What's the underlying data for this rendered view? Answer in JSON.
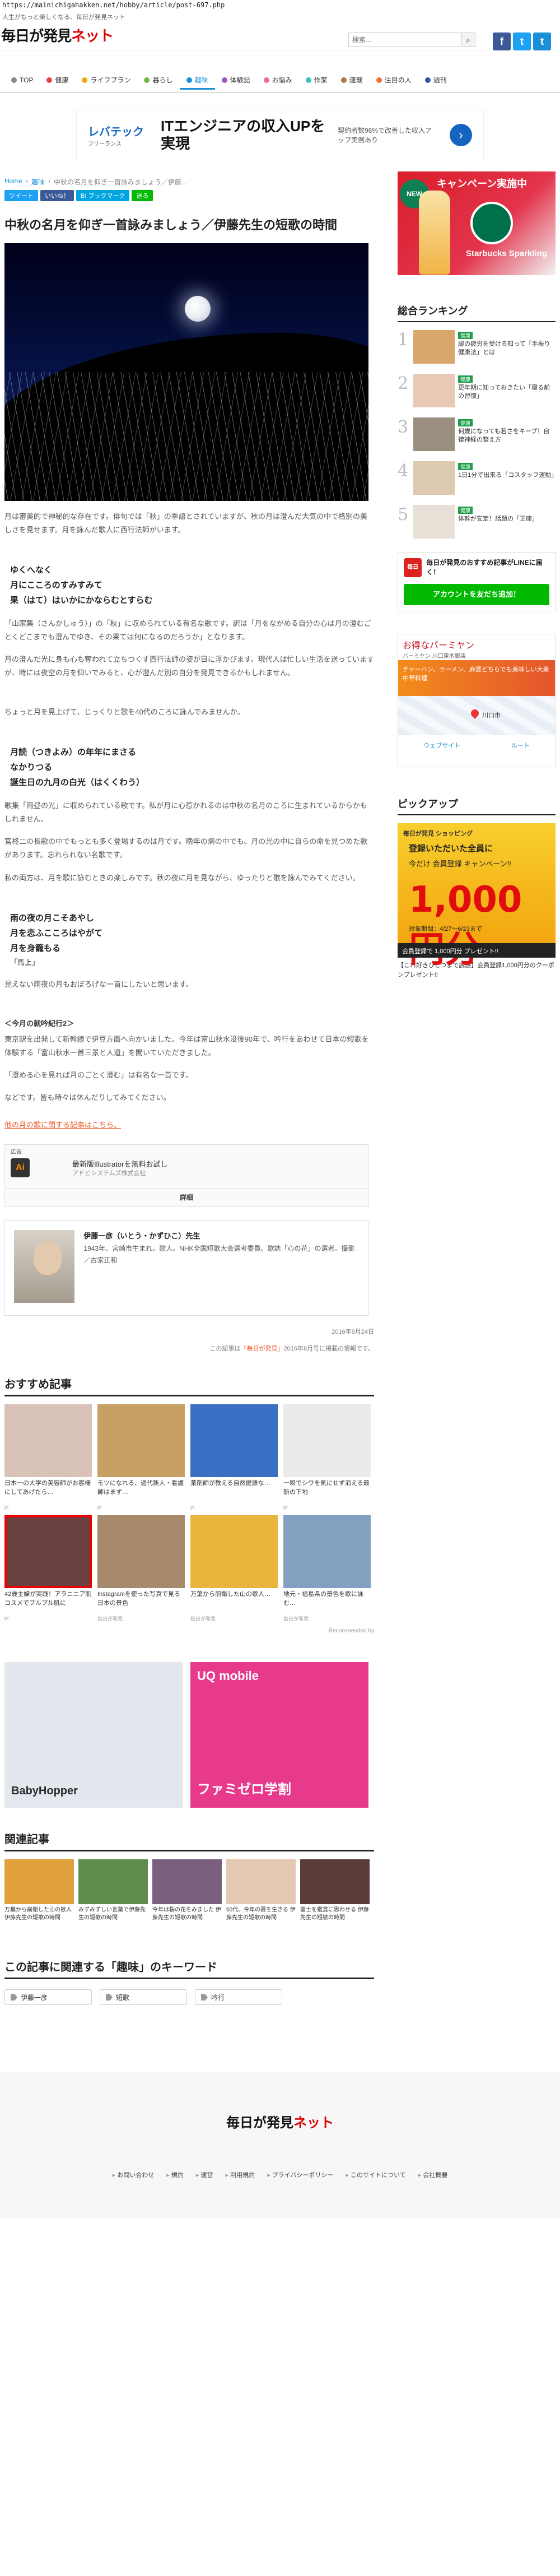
{
  "url": "https://mainichigahakken.net/hobby/article/post-697.php",
  "header": {
    "tagline": "人生がもっと楽しくなる、毎日が発見ネット",
    "logo_main": "毎日が発見",
    "logo_accent": "ネット",
    "search_placeholder": "検索...",
    "social": [
      "f",
      "t",
      "t"
    ]
  },
  "nav": [
    {
      "label": "TOP",
      "color": "#888888"
    },
    {
      "label": "健康",
      "color": "#e8423a"
    },
    {
      "label": "ライフプラン",
      "color": "#f0a81b"
    },
    {
      "label": "暮らし",
      "color": "#6bb93f"
    },
    {
      "label": "趣味",
      "color": "#1b8fd6",
      "active": true
    },
    {
      "label": "体験記",
      "color": "#9b57c2"
    },
    {
      "label": "お悩み",
      "color": "#ec6d9e"
    },
    {
      "label": "作家",
      "color": "#3ec0c5"
    },
    {
      "label": "連載",
      "color": "#b0763f"
    },
    {
      "label": "注目の人",
      "color": "#f56b3c"
    },
    {
      "label": "週刊",
      "color": "#2c57a5"
    }
  ],
  "banner": {
    "brand": "レバテック",
    "brand_sub": "フリーランス",
    "headline": "ITエンジニアの収入UPを実現",
    "sub": "契約者数96%で改善した収入アップ実例あり"
  },
  "breadcrumb": [
    "Home",
    "趣味",
    "中秋の名月を仰ぎ一首詠みましょう／伊藤..."
  ],
  "share": [
    {
      "label": "ツイート",
      "color": "#1da1f2"
    },
    {
      "label": "いいね！",
      "color": "#3b5998"
    },
    {
      "label": "B! ブックマーク",
      "color": "#00a4de"
    },
    {
      "label": "送る",
      "color": "#00b900"
    }
  ],
  "article": {
    "title": "中秋の名月を仰ぎ一首詠みましょう／伊藤先生の短歌の時間",
    "p1": "月は審美的で神秘的な存在です。俳句では「秋」の季語とされていますが、秋の月は澄んだ大気の中で格別の美しさを見せます。月を詠んだ歌人に西行法師がいます。",
    "poem1": [
      "ゆくへなく",
      "月にこころのすみすみて",
      "果（はて）はいかにかならむとすらむ"
    ],
    "p2": "「山家集（さんかしゅう）」の「秋」に収められている有名な歌です。訳は「月をながめる自分の心は月の澄むごとくどこまでも澄んでゆき、その果ては何になるのだろうか」となります。",
    "p3": "月の澄んだ光に身も心も奪われて立ちつくす西行法師の姿が目に浮かびます。現代人は忙しい生活を送っていますが、時には夜空の月を仰いでみると、心が澄んだ別の自分を発見できるかもしれません。",
    "p4": "ちょっと月を見上げて、じっくりと歌を40代のころに詠んでみませんか。",
    "poem2": [
      "月読（つきよみ）の年年にまさる",
      "なかりつる",
      "誕生日の九月の白光（はくくわう）"
    ],
    "p5": "歌集「雨昼の光」に収められている歌です。私が月に心惹かれるのは中秋の名月のころに生まれているからかもしれません。",
    "p6": "宮柊二の長歌の中でもっとも多く登場するのは月です。晩年の病の中でも、月の光の中に自らの命を見つめた歌があります。忘れられない名歌です。",
    "p7": "私の両方は、月を歌に詠むときの楽しみです。秋の夜に月を見ながら、ゆったりと歌を詠んでみてください。",
    "poem3": [
      "雨の夜の月こそあやし",
      "月を恋ふこころはやがて",
      "月を身籠もる"
    ],
    "poem3_note": "「馬上」",
    "p8": "見えない雨夜の月もおぼろげな一首にしたいと思います。",
    "event_title": "＜今月の就吟紀行2＞",
    "p9": "東京駅を出発して新幹線で伊豆方面へ向かいました。今年は富山秋水没後90年で、吟行をあわせて日本の短歌を体験する「富山秋水一首三景と人道」を開いていただきました。",
    "p10": "「澄める心を見れば月のごとく澄む」は有名な一首です。",
    "p11": "などです。皆も時々は休んだりしてみてください。",
    "link": "他の月の歌に関する記事はこちら。",
    "ad": {
      "tag": "広告",
      "title": "最新版Illustratorを無料お試し",
      "sub": "アドビシステムズ株式会社",
      "open": "詳細"
    },
    "author_name": "伊藤一彦（いとう・かずひこ）先生",
    "author_bio": "1943年、宮崎市生まれ。歌人。NHK全国短歌大会選考委員。歌誌「心の花」の選者。撮影／古家正和",
    "pubdate": "2016年8月24日",
    "credit_prefix": "この記事は",
    "credit_link": "『毎日が発見』",
    "credit_suffix": "2016年8月号に掲載の情報です。"
  },
  "recommended": {
    "title": "おすすめ記事",
    "items": [
      {
        "cap": "日本一の大学の美容師がお客様にしてあげたら…",
        "src": "pr",
        "color": "#d9c3b8"
      },
      {
        "cap": "モツになれる、週代新人・看護師はまず…",
        "src": "pr",
        "color": "#c9a064"
      },
      {
        "cap": "薬剤師が教える自然健康な…",
        "src": "pr",
        "color": "#3b6fc4"
      },
      {
        "cap": "一瞬でシワを気にせず消える最新の下地",
        "src": "pr",
        "color": "#ebebeb"
      },
      {
        "cap": "42歳主婦が実践！アラニニア肌コスメでプルプル肌に",
        "src": "pr",
        "color": "#6a4040",
        "highlight": true
      },
      {
        "cap": "Instagramを使った写真で見る日本の景色",
        "src": "毎日が発見",
        "color": "#a78a6c"
      },
      {
        "cap": "万葉から前衛した山の歌人…",
        "src": "毎日が発見",
        "color": "#e8b63c"
      },
      {
        "cap": "地元・福島県の景色を歌に詠む…",
        "src": "毎日が発見",
        "color": "#83a0c0"
      }
    ],
    "footer": "Recommended by"
  },
  "ads": [
    {
      "label": "BabyHopper",
      "color": "#e3e7ee"
    },
    {
      "label": "UQ mobile",
      "sub": "ファミゼロ学割",
      "color": "#e73a8d"
    }
  ],
  "related": {
    "title": "関連記事",
    "items": [
      {
        "cap": "万葉から前衛した山の歌人 伊藤先生の短歌の時間",
        "color": "#e0a03c"
      },
      {
        "cap": "みずみずしい言葉で伊藤先生の短歌の時間",
        "color": "#5f8b4c"
      },
      {
        "cap": "今年は桜の花をみました 伊藤先生の短歌の時間",
        "color": "#7a5f7f"
      },
      {
        "cap": "50代、今年の夏を生きる 伊藤先生の短歌の時間",
        "color": "#e4c9b2"
      },
      {
        "cap": "富士を鑑賞に思わせる 伊藤先生の短歌の時間",
        "color": "#5a3c3a"
      }
    ]
  },
  "keywords": {
    "title": "この記事に関連する「趣味」のキーワード",
    "items": [
      "伊藤一彦",
      "短歌",
      "吟行"
    ]
  },
  "footer": {
    "logo_main": "毎日が発見",
    "logo_accent": "ネット",
    "links": [
      "お問い合わせ",
      "規約",
      "運営",
      "利用規約",
      "プライバシーポリシー",
      "このサイトについて",
      "会社概要"
    ]
  },
  "sidebar": {
    "ad_new": "NEW",
    "ad_campaign": "キャンペーン実施中",
    "ad_brand": "Starbucks Sparkling",
    "ranking_title": "総合ランキング",
    "ranking": [
      {
        "num": "1",
        "tag": "健康",
        "text": "脚の疲労を受ける知って「手振り健康法」とは",
        "color": "#d9a66b"
      },
      {
        "num": "2",
        "tag": "健康",
        "text": "更年期に知っておきたい「寝る前の習慣」",
        "color": "#eac8b6"
      },
      {
        "num": "3",
        "tag": "健康",
        "text": "何歳になっても若さをキープ！自律神経の整え方",
        "color": "#9a8e80"
      },
      {
        "num": "4",
        "tag": "健康",
        "text": "1日1分で出来る「コスタッフ運動」",
        "color": "#dcc9b0"
      },
      {
        "num": "5",
        "tag": "健康",
        "text": "体幹が安定！話題の「正座」",
        "color": "#e6e0d6"
      }
    ],
    "line_title": "毎日が発見のおすすめ記事がLINEに届く！",
    "line_btn": "アカウントを友だち追加！",
    "map_title": "お得なバーミヤン",
    "map_sub": "バーミヤン 川口東本郷店",
    "map_banner": "チャーハン、ラーメン、麻婆どちらでも美味しい大衆中華料理",
    "map_place": "川口市",
    "map_links": [
      "ウェブサイト",
      "ルート"
    ],
    "pickup_title": "ピックアップ",
    "pickup_ad": {
      "line1": "毎日が発見 ショッピング",
      "line2": "登録いただいた全員に",
      "line3": "今だけ 会員登録 キャンペーン!!",
      "line4": "1,000円分",
      "line5": "対象期間：4/27〜6/23まで",
      "line6": "会員登録で 1,000円分 プレゼント!!"
    },
    "pickup_caption": "【これ好きひとつまで誘惑】会員登録1,000円分のクーポンプレゼント!!"
  }
}
